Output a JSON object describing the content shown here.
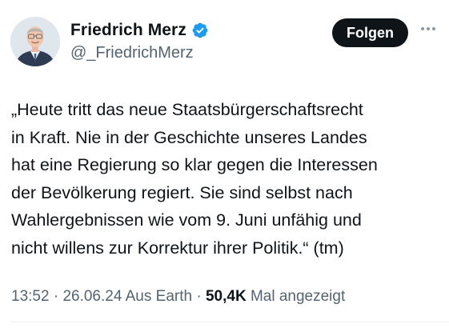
{
  "author": {
    "display_name": "Friedrich Merz",
    "handle": "@_FriedrichMerz",
    "verified": true,
    "verified_color": "#1d9bf0"
  },
  "actions": {
    "follow_label": "Folgen",
    "more_icon": "more-horizontal-icon"
  },
  "tweet": {
    "lines": [
      "„Heute tritt das neue Staatsbürgerschaftsrecht",
      "in Kraft. Nie in der Geschichte unseres Landes",
      "hat eine Regierung so klar gegen die Interessen",
      "der Bevölkerung regiert. Sie sind selbst nach",
      "Wahlergebnissen wie vom 9. Juni unfähig und",
      "nicht willens zur Korrektur ihrer Politik.“ (tm)"
    ]
  },
  "meta": {
    "time": "13:52",
    "sep1": " · ",
    "date": "26.06.24",
    "source": " Aus Earth",
    "sep2": " · ",
    "views_count": "50,4K",
    "views_label": " Mal angezeigt"
  },
  "colors": {
    "text_primary": "#0f1419",
    "text_secondary": "#536471",
    "button_bg": "#0f1419",
    "button_text": "#ffffff"
  }
}
